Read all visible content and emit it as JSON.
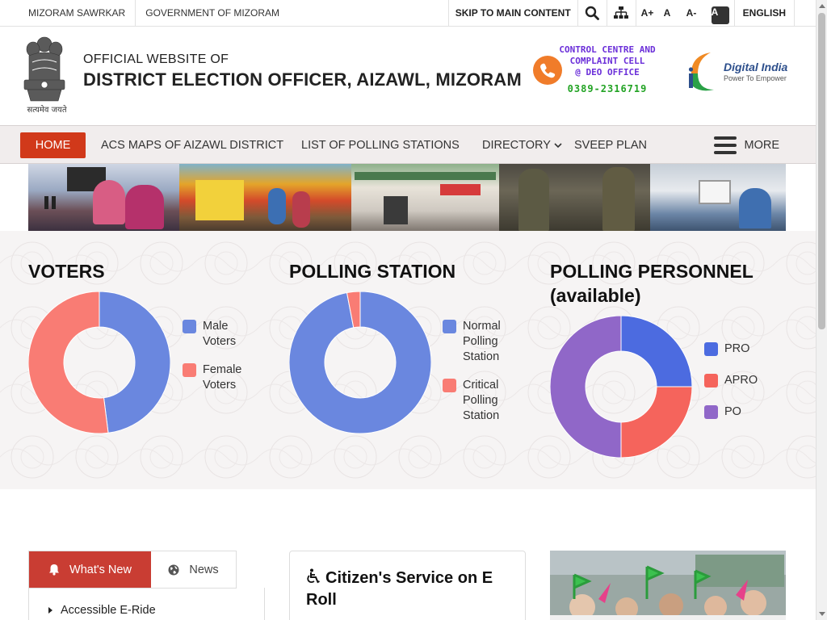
{
  "topbar": {
    "left_links": [
      "MIZORAM SAWRKAR",
      "GOVERNMENT OF MIZORAM"
    ],
    "skip": "SKIP TO MAIN CONTENT",
    "font_sizes": [
      "A+",
      "A",
      "A-",
      "A"
    ],
    "language": "ENGLISH"
  },
  "header": {
    "emblem_motto": "सत्यमेव जयते",
    "subtitle": "OFFICIAL WEBSITE OF",
    "title": "DISTRICT ELECTION OFFICER, AIZAWL, MIZORAM",
    "control_centre": {
      "line1": "CONTROL CENTRE AND",
      "line2": "COMPLAINT CELL",
      "line3": "@ DEO OFFICE",
      "phone": "0389-2316719"
    },
    "digital_india": {
      "name": "Digital India",
      "tagline": "Power To Empower"
    }
  },
  "nav": {
    "home": "HOME",
    "items": [
      "ACS MAPS OF AIZAWL DISTRICT",
      "LIST OF POLLING STATIONS",
      "DIRECTORY",
      "SVEEP PLAN"
    ],
    "more": "MORE"
  },
  "stats": {
    "voters": {
      "title": "VOTERS",
      "legend": [
        {
          "label": "Male Voters",
          "color": "#6a87df",
          "value": 48
        },
        {
          "label": "Female Voters",
          "color": "#f97c74",
          "value": 52
        }
      ]
    },
    "polling_station": {
      "title": "POLLING STATION",
      "legend": [
        {
          "label": "Normal Polling Station",
          "color": "#6a87df",
          "value": 97
        },
        {
          "label": "Critical Polling Station",
          "color": "#f97c74",
          "value": 3
        }
      ]
    },
    "polling_personnel": {
      "title": "POLLING PERSONNEL (available)",
      "legend": [
        {
          "label": "PRO",
          "color": "#4c6be0",
          "value": 25
        },
        {
          "label": "APRO",
          "color": "#f5645c",
          "value": 25
        },
        {
          "label": "PO",
          "color": "#9067c8",
          "value": 50
        }
      ]
    }
  },
  "tabs": {
    "active": "What's New",
    "inactive": "News"
  },
  "whats_new_items": [
    "Accessible E-Ride"
  ],
  "citizen_card": {
    "title": "Citizen's Service on E Roll"
  },
  "colors": {
    "accent": "#d1391a",
    "tab_active": "#c93d33"
  }
}
